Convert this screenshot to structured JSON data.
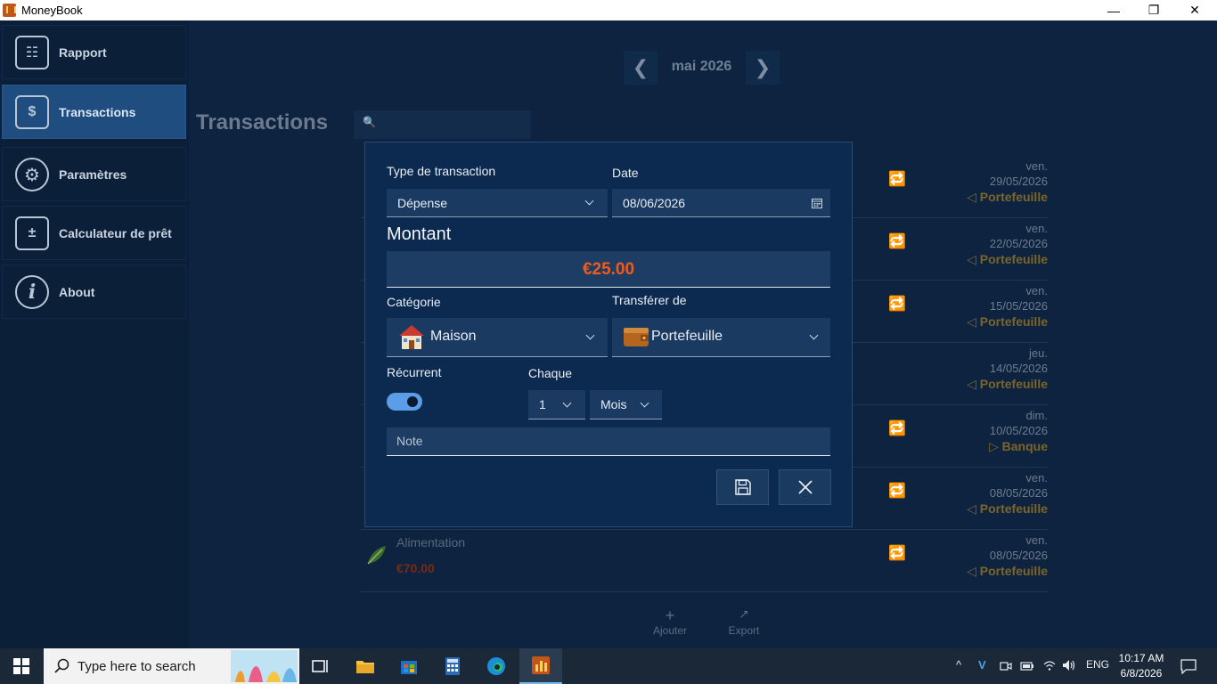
{
  "window": {
    "title": "MoneyBook",
    "minimize": "—",
    "maximize": "❐",
    "close": "✕"
  },
  "sidebar": {
    "items": [
      {
        "label": "Rapport",
        "icon": "report-icon",
        "glyph": "☷"
      },
      {
        "label": "Transactions",
        "icon": "money-transfer-icon",
        "glyph": "$",
        "active": true
      },
      {
        "label": "Paramètres",
        "icon": "settings-gear-icon",
        "glyph": "⚙"
      },
      {
        "label": "Calculateur de prêt",
        "icon": "calculator-icon",
        "glyph": "±"
      },
      {
        "label": "About",
        "icon": "info-icon",
        "glyph": "i"
      }
    ]
  },
  "month_nav": {
    "label": "mai 2026",
    "prev": "❮",
    "next": "❯"
  },
  "page": {
    "title": "Transactions",
    "search_glyph": "🔍",
    "search_value": ""
  },
  "transactions": [
    {
      "day": "ven.",
      "date": "29/05/2026",
      "account": "◁ Portefeuille",
      "repeat": "🔁"
    },
    {
      "day": "ven.",
      "date": "22/05/2026",
      "account": "◁ Portefeuille",
      "repeat": "🔁"
    },
    {
      "day": "ven.",
      "date": "15/05/2026",
      "account": "◁ Portefeuille",
      "repeat": "🔁"
    },
    {
      "day": "jeu.",
      "date": "14/05/2026",
      "account": "◁ Portefeuille",
      "repeat": ""
    },
    {
      "day": "dim.",
      "date": "10/05/2026",
      "account": "▷ Banque",
      "repeat": "🔁"
    },
    {
      "day": "ven.",
      "date": "08/05/2026",
      "account": "◁ Portefeuille",
      "repeat": "🔁"
    },
    {
      "day": "ven.",
      "date": "08/05/2026",
      "account": "◁ Portefeuille",
      "repeat": "🔁",
      "category": "Alimentation",
      "amount": "€70.00"
    }
  ],
  "actions": {
    "add_label": "Ajouter",
    "add_glyph": "+",
    "export_label": "Export",
    "export_glyph": "⭧"
  },
  "dialog": {
    "type_label": "Type de transaction",
    "type_value": "Dépense",
    "date_label": "Date",
    "date_value": "08/06/2026",
    "amount_label": "Montant",
    "amount_value": "€25.00",
    "category_label": "Catégorie",
    "category_value": "Maison",
    "from_label": "Transférer de",
    "from_value": "Portefeuille",
    "recurrent_label": "Récurrent",
    "recurrent_on": true,
    "every_label": "Chaque",
    "every_count": "1",
    "every_unit": "Mois",
    "note_placeholder": "Note"
  },
  "taskbar": {
    "search_placeholder": "Type here to search",
    "language": "ENG",
    "time": "10:17 AM",
    "date": "6/8/2026",
    "tray_up": "^",
    "tray_v": "V"
  },
  "colors": {
    "accent": "#5b9de6",
    "amount": "#f05a1e",
    "account": "#7c6528",
    "dialog": "#0c2a50"
  }
}
